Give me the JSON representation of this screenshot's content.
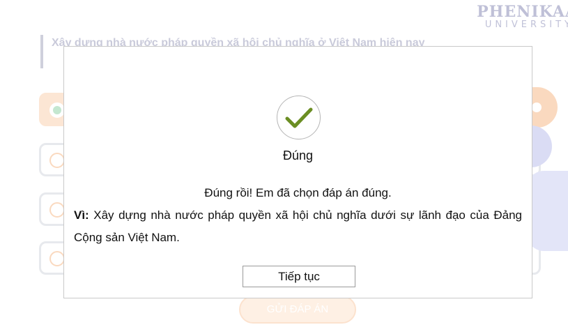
{
  "logo": {
    "main": "PHENIKAA",
    "sub": "UNIVERSITY"
  },
  "question": {
    "text": "Xây dựng nhà nước pháp quyền xã hội chủ nghĩa ở Việt Nam hiện nay"
  },
  "options": [
    {
      "selected": true
    },
    {
      "selected": false
    },
    {
      "selected": false
    },
    {
      "selected": false
    }
  ],
  "submit_label": "GỬI ĐÁP ÁN",
  "modal": {
    "status": "Đúng",
    "message": "Đúng rồi! Em đã chọn đáp án đúng.",
    "reason_label": "Vì:",
    "reason_text": " Xây dựng nhà nước pháp quyền xã hội chủ nghĩa dưới sự lãnh đạo của Đảng Cộng sản Việt Nam.",
    "continue_label": "Tiếp tục",
    "icon": "check-icon",
    "check_color": "#6b8e23"
  }
}
